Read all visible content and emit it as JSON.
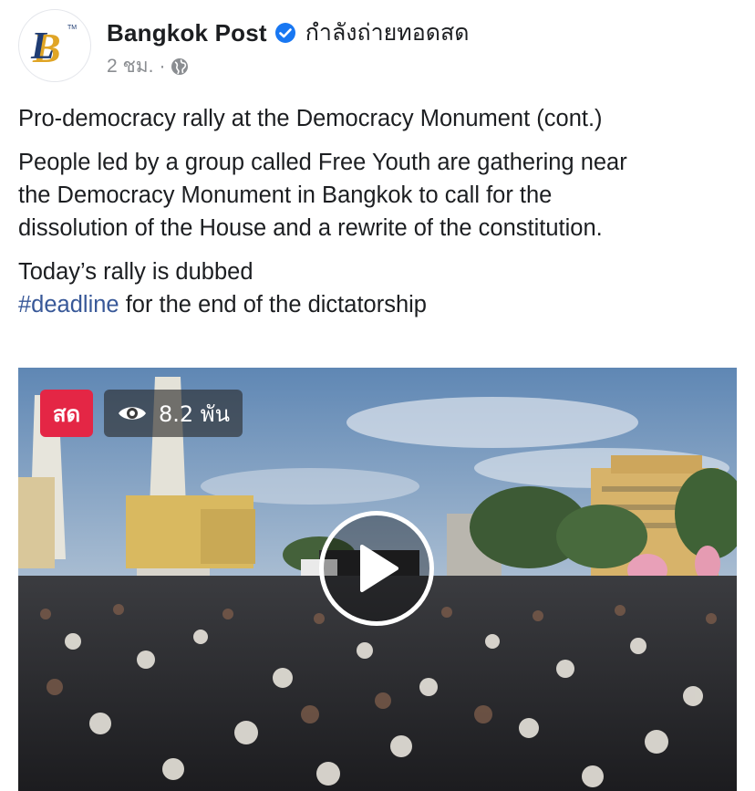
{
  "header": {
    "page_name": "Bangkok Post",
    "live_status": "กำลังถ่ายทอดสด",
    "time_ago": "2 ชม.",
    "separator": "·",
    "avatar_icon": "bangkok-post-logo",
    "verified_icon": "verified-badge-icon",
    "privacy_icon": "globe-icon"
  },
  "post": {
    "title": "Pro-democracy rally at the Democracy Monument (cont.)",
    "paragraph": "People led by a group called Free Youth are gathering near the Democracy Monument in Bangkok to call for the dissolution of the House and a rewrite of the constitution.",
    "line3_start": "Today’s rally is dubbed",
    "hashtag": "#deadline",
    "line3_end": " for the end of the dictatorship"
  },
  "video": {
    "live_badge": "สด",
    "viewer_count": "8.2 พัน",
    "eye_icon": "eye-icon",
    "play_icon": "play-icon"
  },
  "colors": {
    "live_red": "#e42645",
    "verified_blue": "#1877f2",
    "hashtag_blue": "#385898",
    "meta_gray": "#8a8d91"
  }
}
